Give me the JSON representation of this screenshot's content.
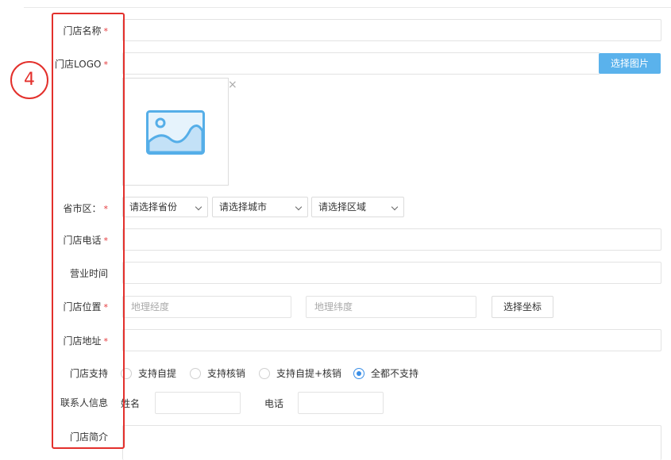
{
  "form": {
    "store_name": {
      "label": "门店名称",
      "required": "*"
    },
    "store_logo": {
      "label": "门店LOGO",
      "required": "*",
      "button": "选择图片",
      "close": "×",
      "icon": "image-placeholder-icon"
    },
    "region": {
      "label": "省市区：",
      "required": "*",
      "province": "请选择省份",
      "city": "请选择城市",
      "district": "请选择区域"
    },
    "phone": {
      "label": "门店电话",
      "required": "*"
    },
    "hours": {
      "label": "营业时间"
    },
    "location": {
      "label": "门店位置",
      "required": "*",
      "lng_placeholder": "地理经度",
      "lat_placeholder": "地理纬度",
      "button": "选择坐标"
    },
    "address": {
      "label": "门店地址",
      "required": "*"
    },
    "support": {
      "label": "门店支持",
      "options": [
        "支持自提",
        "支持核销",
        "支持自提+核销",
        "全都不支持"
      ],
      "selected": "全都不支持"
    },
    "contact": {
      "label": "联系人信息",
      "name_label": "姓名",
      "phone_label": "电话"
    },
    "intro": {
      "label": "门店简介"
    }
  },
  "annotation": {
    "number": "4",
    "color": "#e3302c"
  },
  "colors": {
    "primary_button": "#5ab2ec",
    "radio_active": "#3a8ee6",
    "required": "#e4393c"
  }
}
